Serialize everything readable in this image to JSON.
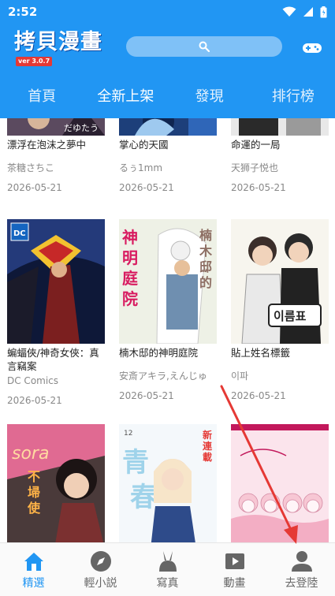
{
  "status_bar": {
    "time": "2:52"
  },
  "app": {
    "title": "拷貝漫畫",
    "version": "ver 3.0.7"
  },
  "tabs": [
    {
      "label": "首頁",
      "active": false
    },
    {
      "label": "全新上架",
      "active": true
    },
    {
      "label": "發現",
      "active": false
    },
    {
      "label": "排行榜",
      "active": false
    }
  ],
  "comics": [
    {
      "title": "漂浮在泡沫之夢中",
      "author": "茶糖さちこ",
      "date": "2026-05-21"
    },
    {
      "title": "掌心的天國",
      "author": "るぅ1mm",
      "date": "2026-05-21"
    },
    {
      "title": "命運的一局",
      "author": "天狮子悦也",
      "date": "2026-05-21"
    },
    {
      "title": "蝙蝠俠/神奇女俠：真言竊案",
      "author": "DC Comics",
      "date": "2026-05-21"
    },
    {
      "title": "楠木邸的神明庭院",
      "author": "安斎アキラ,えんじゅ",
      "date": "2026-05-21"
    },
    {
      "title": "貼上姓名標籤",
      "author": "이파",
      "date": "2026-05-21"
    },
    {
      "title": "",
      "author": "",
      "date": ""
    },
    {
      "title": "",
      "author": "",
      "date": ""
    },
    {
      "title": "",
      "author": "",
      "date": ""
    }
  ],
  "cover_text": {
    "c4_badge": "DC",
    "c5_title": "神明庭院",
    "c5_side": "楠木邸的",
    "c6_label": "이름표",
    "c7_title": "sora",
    "c8_big": "青と春",
    "c8_sub": "新連載",
    "c8_num": "12"
  },
  "bottom_nav": [
    {
      "label": "精選",
      "icon": "home-icon",
      "active": true
    },
    {
      "label": "輕小説",
      "icon": "compass-icon",
      "active": false
    },
    {
      "label": "寫真",
      "icon": "bunny-icon",
      "active": false
    },
    {
      "label": "動畫",
      "icon": "play-icon",
      "active": false
    },
    {
      "label": "去登陸",
      "icon": "user-icon",
      "active": false
    }
  ],
  "colors": {
    "primary": "#2196F3",
    "annotation_arrow": "#e53935"
  }
}
